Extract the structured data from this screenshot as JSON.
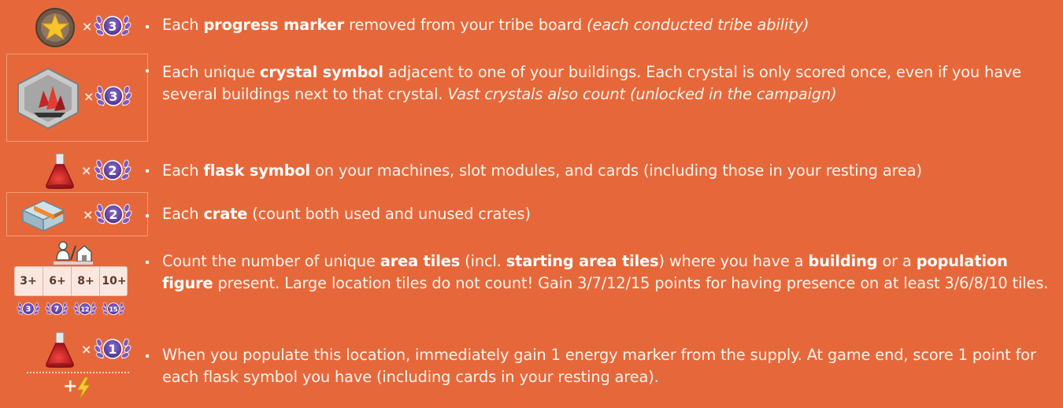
{
  "rows": [
    {
      "icon": "progress-marker-icon",
      "multiplier": "×",
      "points": "3",
      "parts": [
        {
          "t": "Each "
        },
        {
          "t": "progress marker",
          "b": true
        },
        {
          "t": " removed from your tribe board "
        },
        {
          "t": "(each conducted tribe ability)",
          "i": true
        }
      ]
    },
    {
      "icon": "crystal-hex-icon",
      "multiplier": "×",
      "points": "3",
      "parts": [
        {
          "t": "Each unique "
        },
        {
          "t": "crystal symbol",
          "b": true
        },
        {
          "t": " adjacent to one of your buildings. Each crystal is only scored once, even if you have several buildings next to that crystal. "
        },
        {
          "t": "Vast crystals also count (unlocked in the campaign)",
          "i": true
        }
      ]
    },
    {
      "icon": "flask-icon",
      "multiplier": "×",
      "points": "2",
      "parts": [
        {
          "t": "Each "
        },
        {
          "t": "flask symbol",
          "b": true
        },
        {
          "t": " on your machines, slot modules, and cards (including those in your resting area)"
        }
      ]
    },
    {
      "icon": "crate-icon",
      "multiplier": "×",
      "points": "2",
      "parts": [
        {
          "t": "Each "
        },
        {
          "t": "crate",
          "b": true
        },
        {
          "t": " (count both used and unused crates)"
        }
      ]
    },
    {
      "icon": "building-population-icon",
      "thresholds": [
        "3+",
        "6+",
        "8+",
        "10+"
      ],
      "threshold_points": [
        "3",
        "7",
        "12",
        "15"
      ],
      "parts": [
        {
          "t": "Count the number of unique "
        },
        {
          "t": "area tiles",
          "b": true
        },
        {
          "t": " (incl. "
        },
        {
          "t": "starting area tiles",
          "b": true
        },
        {
          "t": ") where you have a "
        },
        {
          "t": "building",
          "b": true
        },
        {
          "t": " or a "
        },
        {
          "t": "population figure",
          "b": true
        },
        {
          "t": " present. Large location tiles do not count! Gain 3/7/12/15 points for having presence on at least 3/6/8/10 tiles."
        }
      ]
    },
    {
      "icon": "flask-icon",
      "multiplier": "×",
      "points": "1",
      "bonus": "+",
      "bonus_icon": "energy-icon",
      "parts": [
        {
          "t": "When you populate this location, immediately gain 1 energy marker from the supply. At game end, score 1 point for each flask symbol you have (including cards in your resting area)."
        }
      ]
    }
  ],
  "colors": {
    "background": "#e6683a",
    "laurel": "#6b4cb0",
    "flask": "#d8262c",
    "star": "#f5c52b"
  }
}
